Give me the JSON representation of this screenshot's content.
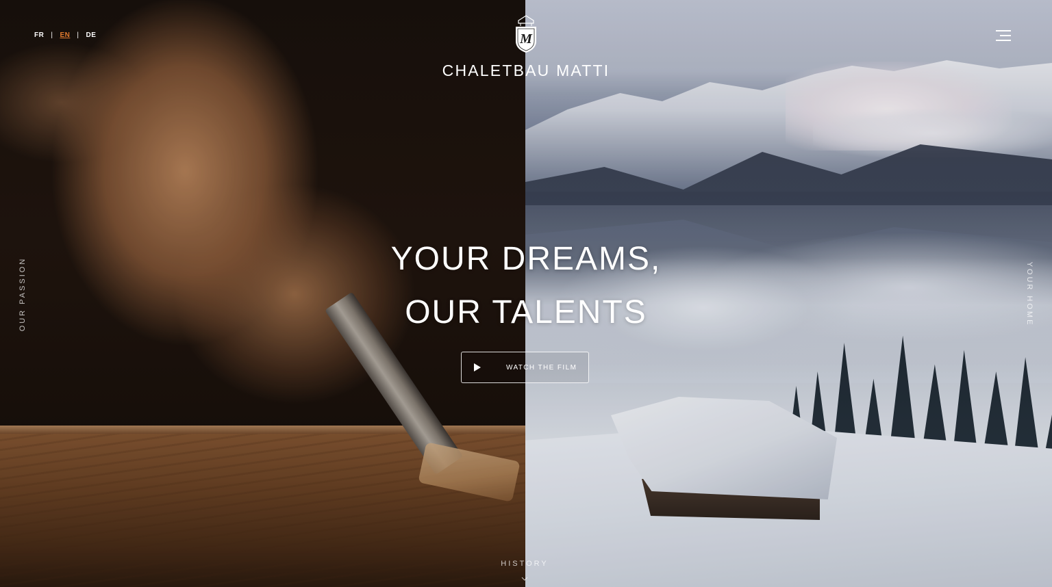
{
  "languages": {
    "fr": "FR",
    "en": "EN",
    "de": "DE",
    "separator": "|",
    "active": "EN"
  },
  "brand": {
    "name": "CHALETBAU MATTI",
    "crest_letter": "M"
  },
  "menu": {
    "icon": "hamburger-menu-icon"
  },
  "side_labels": {
    "left": "OUR PASSION",
    "right": "YOUR HOME"
  },
  "hero": {
    "headline_line1": "YOUR DREAMS,",
    "headline_line2": "OUR TALENTS"
  },
  "watch_button": {
    "label": "WATCH THE FILM",
    "icon": "play-icon"
  },
  "footer": {
    "history_label": "HISTORY",
    "icon": "chevron-down-icon"
  },
  "colors": {
    "accent": "#e07a2e",
    "text": "#ffffff"
  }
}
